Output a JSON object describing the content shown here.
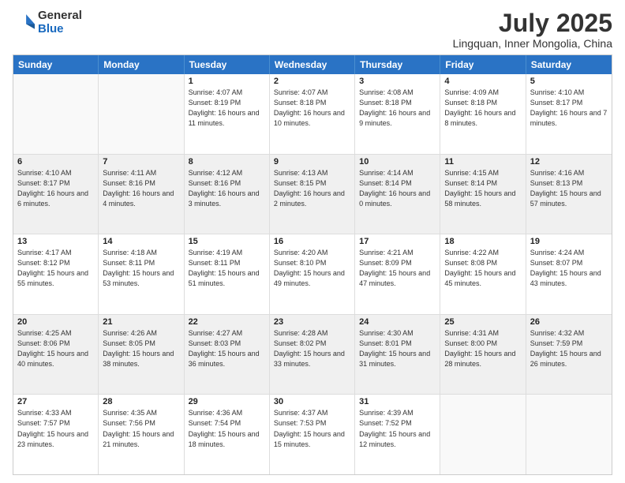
{
  "logo": {
    "general": "General",
    "blue": "Blue"
  },
  "header": {
    "title": "July 2025",
    "subtitle": "Lingquan, Inner Mongolia, China"
  },
  "weekdays": [
    "Sunday",
    "Monday",
    "Tuesday",
    "Wednesday",
    "Thursday",
    "Friday",
    "Saturday"
  ],
  "rows": [
    [
      {
        "day": "",
        "info": "",
        "empty": true
      },
      {
        "day": "",
        "info": "",
        "empty": true
      },
      {
        "day": "1",
        "info": "Sunrise: 4:07 AM\nSunset: 8:19 PM\nDaylight: 16 hours and 11 minutes."
      },
      {
        "day": "2",
        "info": "Sunrise: 4:07 AM\nSunset: 8:18 PM\nDaylight: 16 hours and 10 minutes."
      },
      {
        "day": "3",
        "info": "Sunrise: 4:08 AM\nSunset: 8:18 PM\nDaylight: 16 hours and 9 minutes."
      },
      {
        "day": "4",
        "info": "Sunrise: 4:09 AM\nSunset: 8:18 PM\nDaylight: 16 hours and 8 minutes."
      },
      {
        "day": "5",
        "info": "Sunrise: 4:10 AM\nSunset: 8:17 PM\nDaylight: 16 hours and 7 minutes."
      }
    ],
    [
      {
        "day": "6",
        "info": "Sunrise: 4:10 AM\nSunset: 8:17 PM\nDaylight: 16 hours and 6 minutes."
      },
      {
        "day": "7",
        "info": "Sunrise: 4:11 AM\nSunset: 8:16 PM\nDaylight: 16 hours and 4 minutes."
      },
      {
        "day": "8",
        "info": "Sunrise: 4:12 AM\nSunset: 8:16 PM\nDaylight: 16 hours and 3 minutes."
      },
      {
        "day": "9",
        "info": "Sunrise: 4:13 AM\nSunset: 8:15 PM\nDaylight: 16 hours and 2 minutes."
      },
      {
        "day": "10",
        "info": "Sunrise: 4:14 AM\nSunset: 8:14 PM\nDaylight: 16 hours and 0 minutes."
      },
      {
        "day": "11",
        "info": "Sunrise: 4:15 AM\nSunset: 8:14 PM\nDaylight: 15 hours and 58 minutes."
      },
      {
        "day": "12",
        "info": "Sunrise: 4:16 AM\nSunset: 8:13 PM\nDaylight: 15 hours and 57 minutes."
      }
    ],
    [
      {
        "day": "13",
        "info": "Sunrise: 4:17 AM\nSunset: 8:12 PM\nDaylight: 15 hours and 55 minutes."
      },
      {
        "day": "14",
        "info": "Sunrise: 4:18 AM\nSunset: 8:11 PM\nDaylight: 15 hours and 53 minutes."
      },
      {
        "day": "15",
        "info": "Sunrise: 4:19 AM\nSunset: 8:11 PM\nDaylight: 15 hours and 51 minutes."
      },
      {
        "day": "16",
        "info": "Sunrise: 4:20 AM\nSunset: 8:10 PM\nDaylight: 15 hours and 49 minutes."
      },
      {
        "day": "17",
        "info": "Sunrise: 4:21 AM\nSunset: 8:09 PM\nDaylight: 15 hours and 47 minutes."
      },
      {
        "day": "18",
        "info": "Sunrise: 4:22 AM\nSunset: 8:08 PM\nDaylight: 15 hours and 45 minutes."
      },
      {
        "day": "19",
        "info": "Sunrise: 4:24 AM\nSunset: 8:07 PM\nDaylight: 15 hours and 43 minutes."
      }
    ],
    [
      {
        "day": "20",
        "info": "Sunrise: 4:25 AM\nSunset: 8:06 PM\nDaylight: 15 hours and 40 minutes."
      },
      {
        "day": "21",
        "info": "Sunrise: 4:26 AM\nSunset: 8:05 PM\nDaylight: 15 hours and 38 minutes."
      },
      {
        "day": "22",
        "info": "Sunrise: 4:27 AM\nSunset: 8:03 PM\nDaylight: 15 hours and 36 minutes."
      },
      {
        "day": "23",
        "info": "Sunrise: 4:28 AM\nSunset: 8:02 PM\nDaylight: 15 hours and 33 minutes."
      },
      {
        "day": "24",
        "info": "Sunrise: 4:30 AM\nSunset: 8:01 PM\nDaylight: 15 hours and 31 minutes."
      },
      {
        "day": "25",
        "info": "Sunrise: 4:31 AM\nSunset: 8:00 PM\nDaylight: 15 hours and 28 minutes."
      },
      {
        "day": "26",
        "info": "Sunrise: 4:32 AM\nSunset: 7:59 PM\nDaylight: 15 hours and 26 minutes."
      }
    ],
    [
      {
        "day": "27",
        "info": "Sunrise: 4:33 AM\nSunset: 7:57 PM\nDaylight: 15 hours and 23 minutes."
      },
      {
        "day": "28",
        "info": "Sunrise: 4:35 AM\nSunset: 7:56 PM\nDaylight: 15 hours and 21 minutes."
      },
      {
        "day": "29",
        "info": "Sunrise: 4:36 AM\nSunset: 7:54 PM\nDaylight: 15 hours and 18 minutes."
      },
      {
        "day": "30",
        "info": "Sunrise: 4:37 AM\nSunset: 7:53 PM\nDaylight: 15 hours and 15 minutes."
      },
      {
        "day": "31",
        "info": "Sunrise: 4:39 AM\nSunset: 7:52 PM\nDaylight: 15 hours and 12 minutes."
      },
      {
        "day": "",
        "info": "",
        "empty": true
      },
      {
        "day": "",
        "info": "",
        "empty": true
      }
    ]
  ]
}
